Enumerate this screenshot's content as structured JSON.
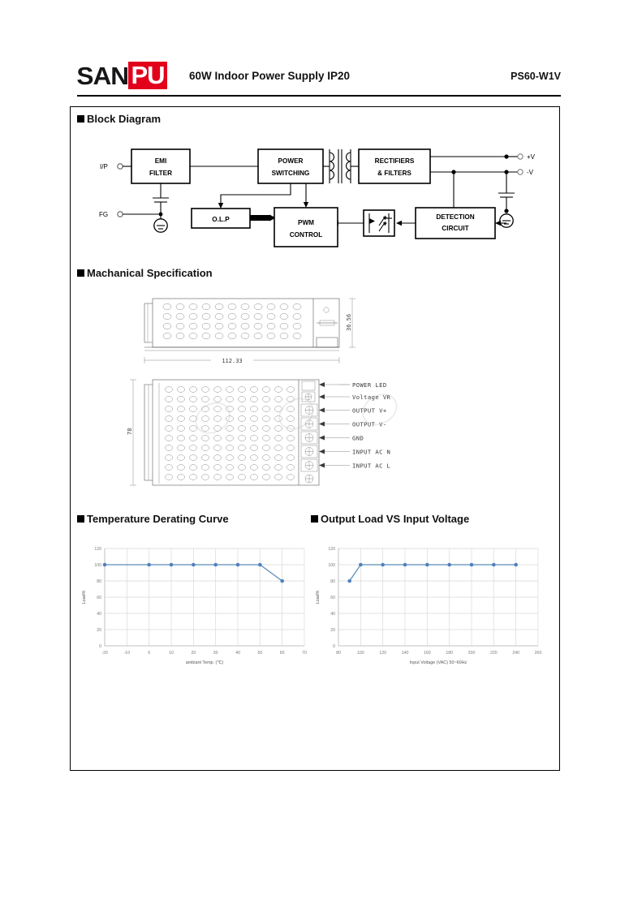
{
  "header": {
    "logo_dark": "SAN",
    "logo_red": "PU",
    "title": "60W Indoor Power Supply IP20",
    "model": "PS60-W1V",
    "brand_red": "#e2001a"
  },
  "sections": {
    "block_diagram": "Block Diagram",
    "mechanical": "Machanical Specification",
    "derating": "Temperature Derating Curve",
    "load_vs_voltage": "Output Load VS Input Voltage"
  },
  "block_diagram": {
    "ports": {
      "input": "I/P",
      "ground": "FG",
      "out_positive": "+V",
      "out_negative": "-V"
    },
    "blocks": [
      {
        "id": "emi",
        "line1": "EMI",
        "line2": "FILTER"
      },
      {
        "id": "power_switching",
        "line1": "POWER",
        "line2": "SWITCHING"
      },
      {
        "id": "rectifiers",
        "line1": "RECTIFIERS",
        "line2": "& FILTERS"
      },
      {
        "id": "olp",
        "line1": "O.L.P",
        "line2": ""
      },
      {
        "id": "pwm",
        "line1": "PWM",
        "line2": "CONTROL"
      },
      {
        "id": "detection",
        "line1": "DETECTION",
        "line2": "CIRCUIT"
      }
    ]
  },
  "mechanical": {
    "dimensions": {
      "length": "112.33",
      "height": "36.56",
      "width": "78"
    },
    "terminals": [
      "POWER LED",
      "Voltage VR",
      "OUTPUT V+",
      "OUTPUT V-",
      "GND",
      "INPUT AC N",
      "INPUT AC L"
    ]
  },
  "chart_data": [
    {
      "id": "derating",
      "type": "line",
      "title": "Temperature Derating Curve",
      "xlabel": "ambiant Temp. (℃)",
      "ylabel": "Load%",
      "xlim": [
        -20,
        70
      ],
      "ylim": [
        0,
        120
      ],
      "xticks": [
        -20,
        -10,
        0,
        10,
        20,
        30,
        40,
        50,
        60,
        70
      ],
      "yticks": [
        0,
        20,
        40,
        60,
        80,
        100,
        120
      ],
      "grid": true,
      "legend": "none",
      "x": [
        -20,
        0,
        10,
        20,
        30,
        40,
        50,
        60
      ],
      "values": [
        100,
        100,
        100,
        100,
        100,
        100,
        100,
        80
      ],
      "series_color": "#4f81bd"
    },
    {
      "id": "load_vs_voltage",
      "type": "line",
      "title": "Output Load VS Input Voltage",
      "xlabel": "Input Voltage (VAC) 50~60Hz",
      "ylabel": "Load%",
      "xlim": [
        80,
        260
      ],
      "ylim": [
        0,
        120
      ],
      "xticks": [
        80,
        100,
        120,
        140,
        160,
        180,
        200,
        220,
        240,
        260
      ],
      "yticks": [
        0,
        20,
        40,
        60,
        80,
        100,
        120
      ],
      "grid": true,
      "legend": "none",
      "x": [
        90,
        100,
        120,
        140,
        160,
        180,
        200,
        220,
        240
      ],
      "values": [
        80,
        100,
        100,
        100,
        100,
        100,
        100,
        100,
        100
      ],
      "series_color": "#4f81bd"
    }
  ]
}
